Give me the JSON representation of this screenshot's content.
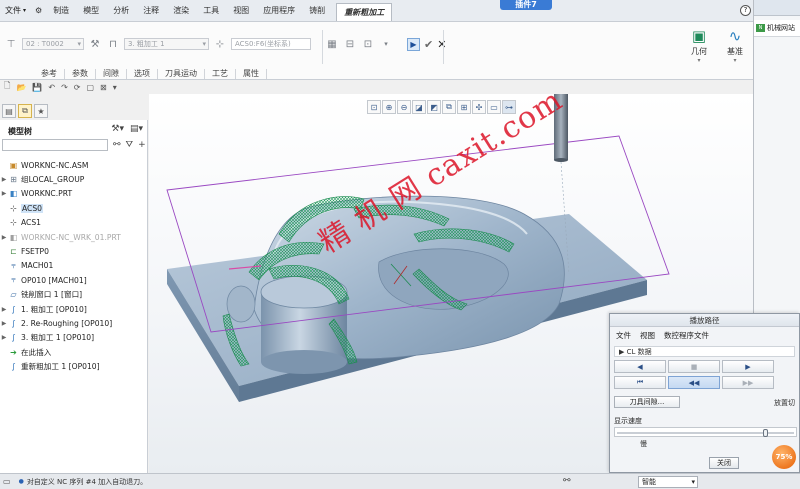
{
  "menubar": {
    "file_label": "文件",
    "tabs": [
      {
        "label": "制造"
      },
      {
        "label": "模型"
      },
      {
        "label": "分析"
      },
      {
        "label": "注释"
      },
      {
        "label": "渲染"
      },
      {
        "label": "工具"
      },
      {
        "label": "视图"
      },
      {
        "label": "应用程序"
      },
      {
        "label": "铸削"
      }
    ],
    "active_tab": "重新粗加工",
    "top_button": "插件7 ",
    "icons": [
      "help-icon",
      "minimize-icon",
      "restore-icon",
      "close-icon"
    ]
  },
  "ribbon": {
    "machine_select": "02 : T0002",
    "step_select": "3. 粗加工 1",
    "csys_field": "ACS0:F6(坐标系)",
    "tabs": [
      {
        "label": "参考"
      },
      {
        "label": "参数"
      },
      {
        "label": "间隙"
      },
      {
        "label": "选项"
      },
      {
        "label": "刀具运动"
      },
      {
        "label": "工艺"
      },
      {
        "label": "属性"
      }
    ],
    "geometry_label": "几何",
    "datum_label": "基准"
  },
  "browser": {
    "link_label": "机械网站"
  },
  "model_tree": {
    "title": "模型树",
    "search_placeholder": "",
    "items": [
      {
        "label": "WORKNC-NC.ASM"
      },
      {
        "label": "组LOCAL_GROUP"
      },
      {
        "label": "WORKNC.PRT"
      },
      {
        "label": "ACS0"
      },
      {
        "label": "ACS1"
      },
      {
        "label": "WORKNC-NC_WRK_01.PRT"
      },
      {
        "label": "FSETP0"
      },
      {
        "label": "MACH01"
      },
      {
        "label": "OP010 [MACH01]"
      },
      {
        "label": "铣削窗口 1 [窗口]"
      },
      {
        "label": "1. 粗加工 [OP010]"
      },
      {
        "label": "2. Re-Roughing [OP010]"
      },
      {
        "label": "3. 粗加工 1 [OP010]"
      },
      {
        "label": "在此插入"
      },
      {
        "label": "重新粗加工 1 [OP010]"
      }
    ]
  },
  "viewport": {
    "watermark": "精 机 网 caxit.com"
  },
  "dialog": {
    "title": "播放路径",
    "menus": [
      {
        "label": "文件"
      },
      {
        "label": "视图"
      },
      {
        "label": "数控程序文件"
      }
    ],
    "cl_label": "CL 数据",
    "cutter_label": "刀具间隙...",
    "setup_label": "放置切",
    "speed_label": "显示速度",
    "speed_value": 0.85,
    "slow_label": "慢",
    "close_label": "关闭",
    "badge_label": "75%"
  },
  "statusbar": {
    "message": "对自定义 NC 序列 #4 加入自动退刀。",
    "filter_value": "智能"
  }
}
